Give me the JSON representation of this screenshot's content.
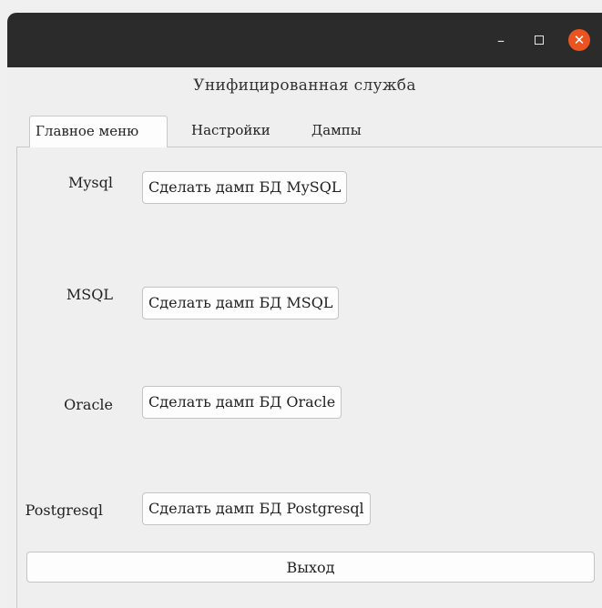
{
  "window": {
    "title": "Унифицированная служба",
    "controls": {
      "minimize_icon": "minimize-icon",
      "maximize_icon": "maximize-icon",
      "close_icon": "close-icon",
      "close_color": "#e95420"
    }
  },
  "tabs": [
    {
      "label": "Главное меню",
      "active": true
    },
    {
      "label": "Настройки",
      "active": false
    },
    {
      "label": "Дампы",
      "active": false
    }
  ],
  "main": {
    "rows": [
      {
        "label": "Mysql",
        "button": "Сделать дамп БД MySQL"
      },
      {
        "label": "MSQL",
        "button": "Сделать дамп БД MSQL"
      },
      {
        "label": "Oracle",
        "button": "Сделать дамп БД Oracle"
      },
      {
        "label": "Postgresql",
        "button": "Сделать дамп БД Postgresql"
      }
    ],
    "exit_label": "Выход"
  }
}
